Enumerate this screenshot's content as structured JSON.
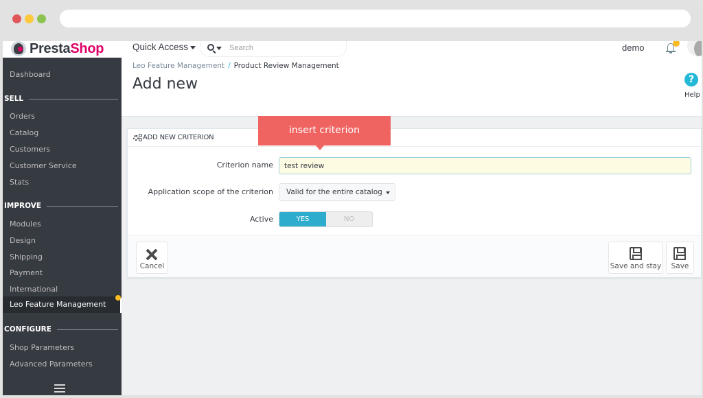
{
  "header": {
    "logo_main": "Presta",
    "logo_accent": "Shop",
    "quick_access_label": "Quick Access",
    "search_placeholder": "Search",
    "user_name": "demo"
  },
  "sidebar": {
    "dashboard": "Dashboard",
    "sections": [
      {
        "title": "SELL",
        "items": [
          "Orders",
          "Catalog",
          "Customers",
          "Customer Service",
          "Stats"
        ]
      },
      {
        "title": "IMPROVE",
        "items": [
          "Modules",
          "Design",
          "Shipping",
          "Payment",
          "International",
          "Leo Feature Management"
        ]
      },
      {
        "title": "CONFIGURE",
        "items": [
          "Shop Parameters",
          "Advanced Parameters"
        ]
      }
    ],
    "active_item": "Leo Feature Management"
  },
  "toolbar": {
    "breadcrumb": [
      "Leo Feature Management",
      "Product Review Management"
    ],
    "title": "Add new",
    "help_label": "Help"
  },
  "panel": {
    "heading": "ADD NEW CRITERION",
    "fields": {
      "criterion_name_label": "Criterion name",
      "criterion_name_value": "test review",
      "scope_label": "Application scope of the criterion",
      "scope_value": "Valid for the entire catalog",
      "active_label": "Active",
      "active_yes": "YES",
      "active_no": "NO",
      "active_value": "YES"
    },
    "footer": {
      "cancel": "Cancel",
      "save_and_stay": "Save and stay",
      "save": "Save"
    }
  },
  "tooltip": {
    "text": "insert criterion",
    "color": "#ef6461"
  },
  "colors": {
    "accent": "#25b9d7",
    "brand": "#df0067",
    "sidebar_bg": "#363a41",
    "notification": "#fbbb22"
  }
}
